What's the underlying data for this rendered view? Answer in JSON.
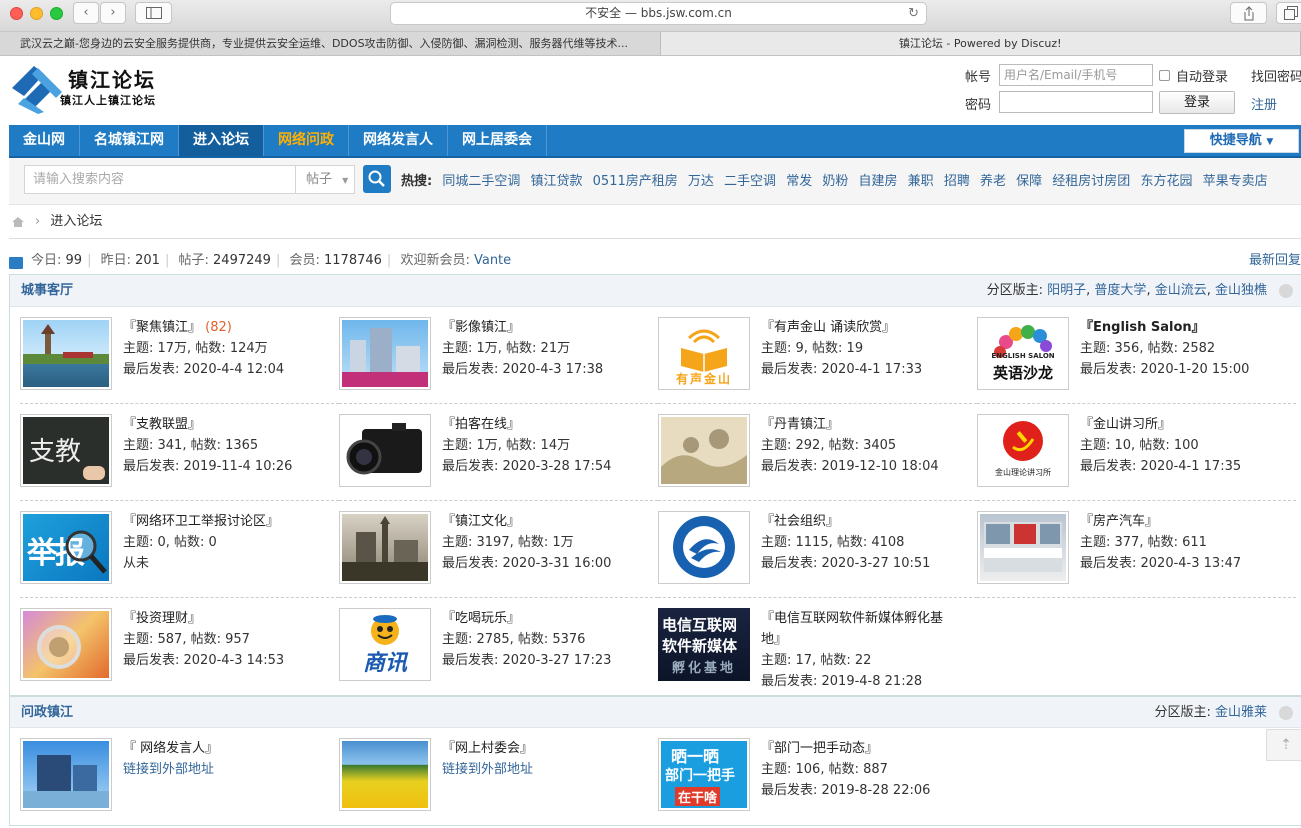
{
  "browser": {
    "address_security": "不安全 —",
    "address_host": "bbs.jsw.com.cn",
    "tabs": [
      {
        "title": "武汉云之巅-您身边的云安全服务提供商，专业提供云安全运维、DDOS攻击防御、入侵防御、漏洞检测、服务器代维等技术..."
      },
      {
        "title": "镇江论坛 - Powered by Discuz!"
      }
    ]
  },
  "header": {
    "logo_title": "镇江论坛",
    "logo_sub": "镇江人上镇江论坛",
    "login": {
      "account_label": "帐号",
      "account_placeholder": "用户名/Email/手机号",
      "auto_login": "自动登录",
      "find_password": "找回密码",
      "password_label": "密码",
      "login_button": "登录",
      "register": "注册"
    }
  },
  "nav": {
    "items": [
      "金山网",
      "名城镇江网",
      "进入论坛",
      "网络问政",
      "网络发言人",
      "网上居委会"
    ],
    "quick_nav": "快捷导航"
  },
  "search": {
    "placeholder": "请输入搜索内容",
    "type": "帖子",
    "hot_label": "热搜:",
    "hot": [
      "同城二手空调",
      "镇江贷款",
      "0511房产租房",
      "万达",
      "二手空调",
      "常发",
      "奶粉",
      "自建房",
      "兼职",
      "招聘",
      "养老",
      "保障",
      "经租房讨房团",
      "东方花园",
      "苹果专卖店"
    ]
  },
  "breadcrumb": {
    "current": "进入论坛"
  },
  "stats": {
    "today_label": "今日:",
    "today": "99",
    "yesterday_label": "昨日:",
    "yesterday": "201",
    "posts_label": "帖子:",
    "posts": "2497249",
    "members_label": "会员:",
    "members": "1178746",
    "new_member_label": "欢迎新会员:",
    "new_member": "Vante",
    "latest": "最新回复"
  },
  "sections": [
    {
      "title": "城事客厅",
      "mods_label": "分区版主:",
      "mods": [
        "阳明子",
        "普度大学",
        "金山流云",
        "金山独樵"
      ],
      "forums": [
        {
          "name": "『聚焦镇江』",
          "count": "(82)",
          "line2": "主题: 17万, 帖数: 124万",
          "line3": "最后发表: 2020-4-4 12:04"
        },
        {
          "name": "『影像镇江』",
          "line2": "主题: 1万, 帖数: 21万",
          "line3": "最后发表: 2020-4-3 17:38"
        },
        {
          "name": "『有声金山 诵读欣赏』",
          "line2": "主题: 9, 帖数: 19",
          "line3": "最后发表: 2020-4-1 17:33",
          "img_text": "有声金山"
        },
        {
          "name": "『English Salon』",
          "line2": "主题: 356, 帖数: 2582",
          "line3": "最后发表: 2020-1-20 15:00",
          "img_text": "英语沙龙",
          "img_sub": "ENGLISH SALON"
        },
        {
          "name": "『支教联盟』",
          "line2": "主题: 341, 帖数: 1365",
          "line3": "最后发表: 2019-11-4 10:26",
          "img_text": "支教"
        },
        {
          "name": "『拍客在线』",
          "line2": "主题: 1万, 帖数: 14万",
          "line3": "最后发表: 2020-3-28 17:54"
        },
        {
          "name": "『丹青镇江』",
          "line2": "主题: 292, 帖数: 3405",
          "line3": "最后发表: 2019-12-10 18:04"
        },
        {
          "name": "『金山讲习所』",
          "line2": "主题: 10, 帖数: 100",
          "line3": "最后发表: 2020-4-1 17:35",
          "img_text": "金山理论讲习所"
        },
        {
          "name": "『网络环卫工举报讨论区』",
          "line2": "主题: 0, 帖数: 0",
          "line3": "从未",
          "img_text": "举报"
        },
        {
          "name": "『镇江文化』",
          "line2": "主题: 3197, 帖数: 1万",
          "line3": "最后发表: 2020-3-31 16:00"
        },
        {
          "name": "『社会组织』",
          "line2": "主题: 1115, 帖数: 4108",
          "line3": "最后发表: 2020-3-27 10:51"
        },
        {
          "name": "『房产汽车』",
          "line2": "主题: 377, 帖数: 611",
          "line3": "最后发表: 2020-4-3 13:47"
        },
        {
          "name": "『投资理财』",
          "line2": "主题: 587, 帖数: 957",
          "line3": "最后发表: 2020-4-3 14:53"
        },
        {
          "name": "『吃喝玩乐』",
          "line2": "主题: 2785, 帖数: 5376",
          "line3": "最后发表: 2020-3-27 17:23",
          "img_text": "商讯"
        },
        {
          "name": "『电信互联网软件新媒体孵化基地』",
          "line2": "主题: 17, 帖数: 22",
          "line3": "最后发表: 2019-4-8 21:28",
          "img_text": "电信互联网",
          "img_text2": "软件新媒体",
          "img_text3": "孵化基地"
        }
      ]
    },
    {
      "title": "问政镇江",
      "mods_label": "分区版主:",
      "mods": [
        "金山雅莱"
      ],
      "forums": [
        {
          "name": "『 网络发言人』",
          "link": "链接到外部地址"
        },
        {
          "name": "『网上村委会』",
          "link": "链接到外部地址"
        },
        {
          "name": "『部门一把手动态』",
          "line2": "主题: 106, 帖数: 887",
          "line3": "最后发表: 2019-8-28 22:06",
          "img_text": "晒一晒",
          "img_text2": "部门一把手",
          "img_text3": "在干啥"
        }
      ]
    }
  ]
}
